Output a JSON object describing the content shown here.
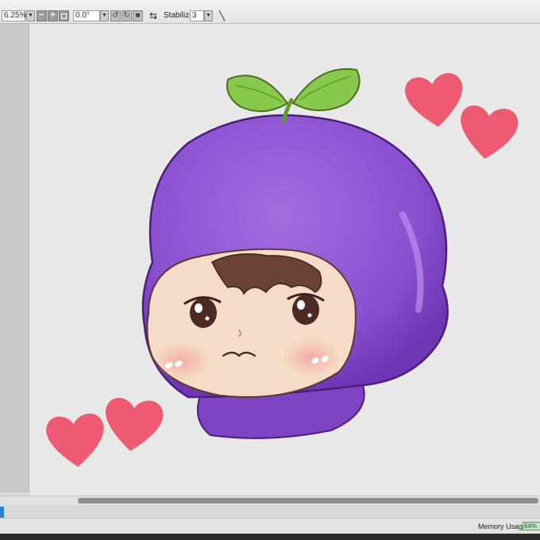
{
  "toolbar": {
    "zoom_value": "6.25%",
    "rotation_value": "0.0°",
    "stabilizer_label": "Stabilizer",
    "stabilizer_value": "3",
    "zoom_out_glyph": "−",
    "zoom_in_glyph": "+",
    "dropdown_glyph": "▼"
  },
  "icons": {
    "zoom_out": "minus-icon",
    "zoom_in": "plus-icon",
    "fit": "square-icon",
    "rotate_left": "rotate-ccw-icon",
    "rotate_right": "rotate-cw-icon",
    "reset_rotation": "reset-icon",
    "flip": "swap-arrows-icon",
    "pen": "pen-icon"
  },
  "canvas": {
    "artwork": "chibi character wearing purple eggplant hood with green sprout and pink hearts",
    "colors": {
      "hood": "#8a4fd0",
      "leaf": "#7cc24a",
      "heart": "#ee5a72",
      "skin": "#f4dcc8",
      "hair": "#6b4335",
      "background": "#e8e8e8"
    }
  },
  "status": {
    "memory_label": "Memory Usage",
    "memory_value": "64%"
  }
}
